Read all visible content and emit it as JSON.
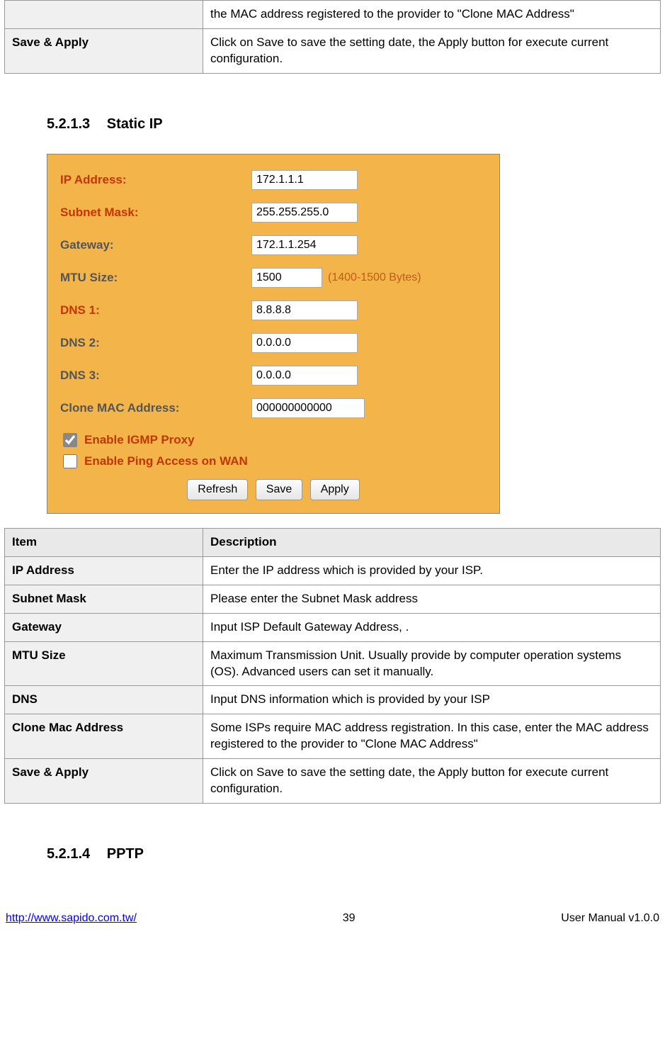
{
  "top_table": {
    "rows": [
      {
        "item": "",
        "desc": "the MAC address registered to the provider to \"Clone MAC Address\""
      },
      {
        "item": "Save & Apply",
        "desc": "Click on Save to save the setting date, the Apply button for execute current configuration."
      }
    ]
  },
  "section1": {
    "number": "5.2.1.3",
    "title": "Static IP"
  },
  "form": {
    "ip_label": "IP Address:",
    "ip_value": "172.1.1.1",
    "subnet_label": "Subnet Mask:",
    "subnet_value": "255.255.255.0",
    "gateway_label": "Gateway:",
    "gateway_value": "172.1.1.254",
    "mtu_label": "MTU Size:",
    "mtu_value": "1500",
    "mtu_hint": "(1400-1500 Bytes)",
    "dns1_label": "DNS 1:",
    "dns1_value": "8.8.8.8",
    "dns2_label": "DNS 2:",
    "dns2_value": "0.0.0.0",
    "dns3_label": "DNS 3:",
    "dns3_value": "0.0.0.0",
    "clone_label": "Clone MAC Address:",
    "clone_value": "000000000000",
    "igmp_label": "Enable IGMP Proxy",
    "ping_label": "Enable Ping Access on WAN",
    "refresh": "Refresh",
    "save": "Save",
    "apply": "Apply"
  },
  "chart_data": {
    "type": "table",
    "title": "Static IP configuration form values",
    "rows": [
      {
        "label": "IP Address",
        "value": "172.1.1.1"
      },
      {
        "label": "Subnet Mask",
        "value": "255.255.255.0"
      },
      {
        "label": "Gateway",
        "value": "172.1.1.254"
      },
      {
        "label": "MTU Size",
        "value": "1500",
        "hint": "(1400-1500 Bytes)"
      },
      {
        "label": "DNS 1",
        "value": "8.8.8.8"
      },
      {
        "label": "DNS 2",
        "value": "0.0.0.0"
      },
      {
        "label": "DNS 3",
        "value": "0.0.0.0"
      },
      {
        "label": "Clone MAC Address",
        "value": "000000000000"
      },
      {
        "label": "Enable IGMP Proxy",
        "value": true
      },
      {
        "label": "Enable Ping Access on WAN",
        "value": false
      }
    ]
  },
  "desc_table": {
    "header_item": "Item",
    "header_desc": "Description",
    "rows": [
      {
        "item": "IP Address",
        "desc": "Enter the IP address which is provided by your ISP."
      },
      {
        "item": "Subnet Mask",
        "desc": "Please enter the Subnet Mask address"
      },
      {
        "item": "Gateway",
        "desc": "Input ISP Default Gateway Address, ."
      },
      {
        "item": "MTU Size",
        "desc": "Maximum Transmission Unit. Usually provide by computer operation systems (OS). Advanced users can set it manually."
      },
      {
        "item": "DNS",
        "desc": "Input DNS information which is provided by your ISP"
      },
      {
        "item": "Clone Mac Address",
        "desc": "Some ISPs require MAC address registration. In this case, enter the MAC address registered to the provider to \"Clone MAC Address\""
      },
      {
        "item": "Save & Apply",
        "desc": "Click on Save to save the setting date, the Apply button for execute current configuration."
      }
    ]
  },
  "section2": {
    "number": "5.2.1.4",
    "title": "PPTP"
  },
  "footer": {
    "url": "http://www.sapido.com.tw/",
    "page": "39",
    "right": "User Manual v1.0.0"
  }
}
